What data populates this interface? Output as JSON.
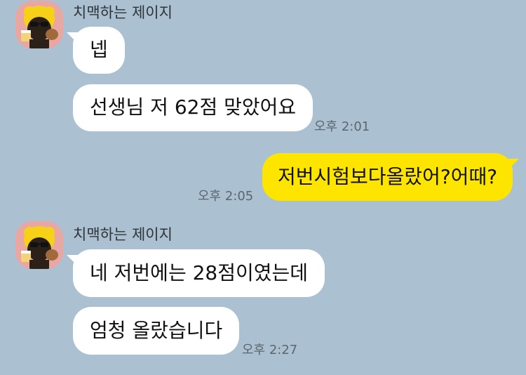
{
  "chat": {
    "group1": {
      "sender": "치맥하는 제이지",
      "messages": [
        {
          "text": "넵"
        },
        {
          "text": "선생님 저 62점 맞았어요",
          "time": "오후 2:01"
        }
      ]
    },
    "mine": {
      "text": "저번시험보다올랐어?어때?",
      "time": "오후 2:05"
    },
    "group2": {
      "sender": "치맥하는 제이지",
      "messages": [
        {
          "text": "네 저번에는 28점이였는데"
        },
        {
          "text": "엄청 올랐습니다",
          "time": "오후 2:27"
        }
      ]
    }
  },
  "colors": {
    "background": "#abc1d1",
    "incoming_bubble": "#ffffff",
    "outgoing_bubble": "#fee500",
    "avatar_bg": "#e9a7a3"
  },
  "icons": {
    "avatar": "jay-g-character-avatar-icon"
  }
}
